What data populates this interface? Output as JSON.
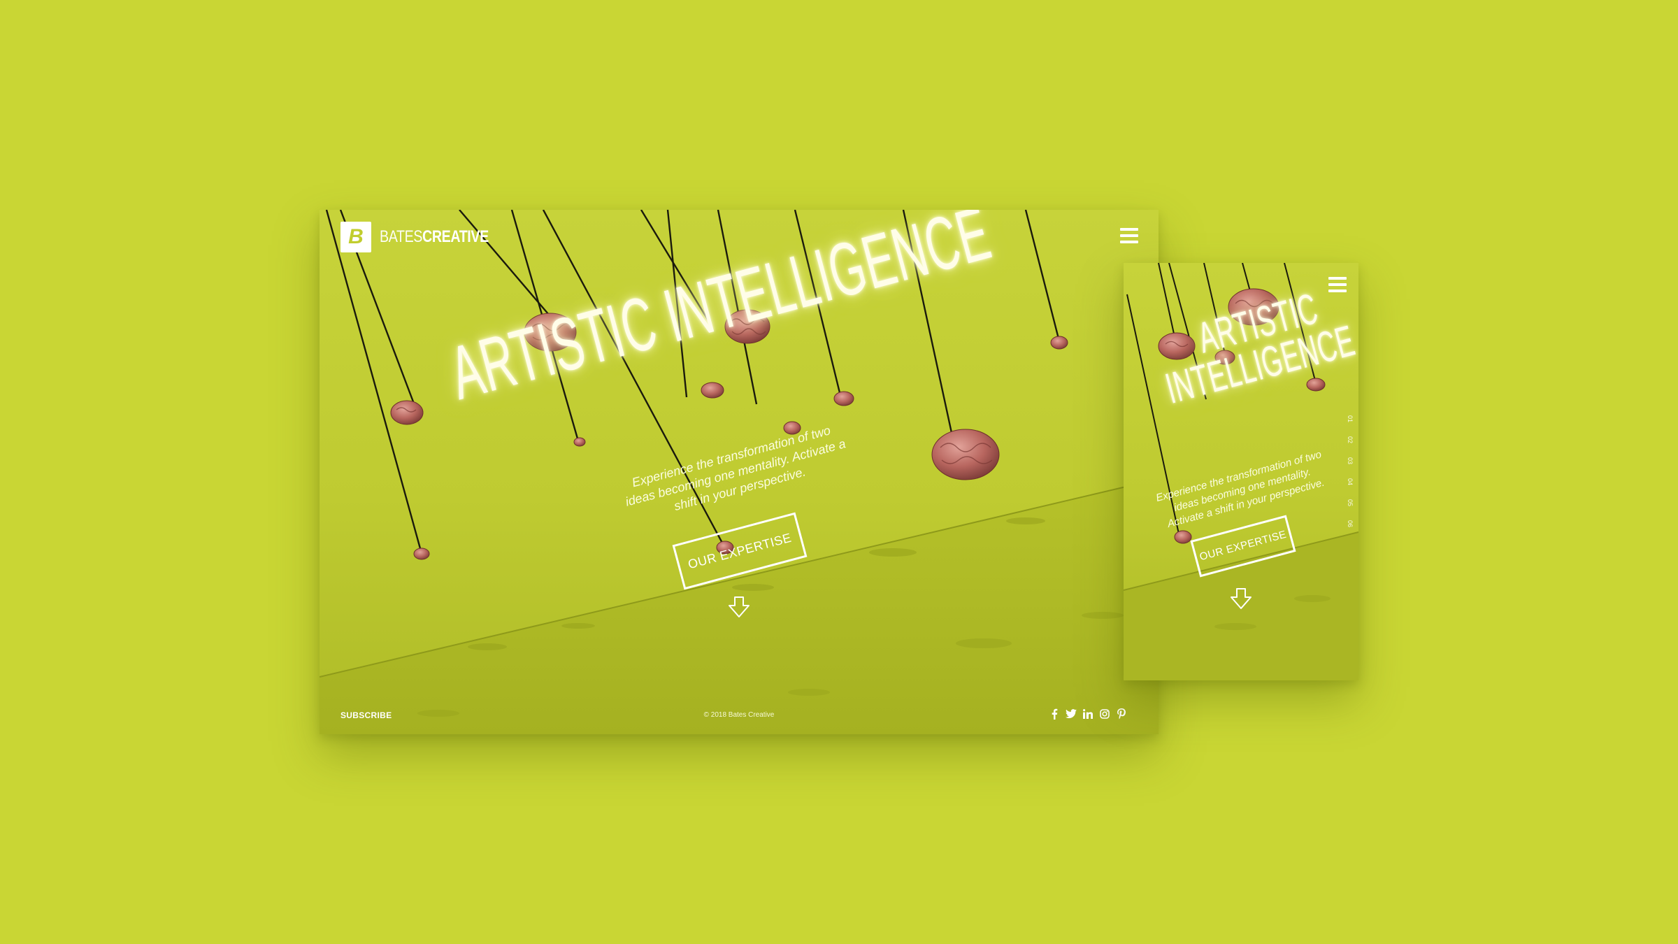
{
  "colors": {
    "background": "#c9d634",
    "accent": "#c1cd2e",
    "text": "#ffffff"
  },
  "brand": {
    "logo_letter": "B",
    "name_part1": "BATES",
    "name_part2": "CREATIVE"
  },
  "hero": {
    "headline": "ARTISTIC INTELLIGENCE",
    "headline_mobile_line1": "ARTISTIC",
    "headline_mobile_line2": "INTELLIGENCE",
    "tagline": "Experience the transformation of two ideas becoming one mentality. Activate a shift in your perspective.",
    "cta_label": "OUR EXPERTISE"
  },
  "footer": {
    "subscribe_label": "SUBSCRIBE",
    "copyright": "© 2018 Bates Creative",
    "social_icons": [
      "facebook-icon",
      "twitter-icon",
      "linkedin-icon",
      "instagram-icon",
      "pinterest-icon"
    ]
  },
  "mobile": {
    "pager": [
      "01",
      "02",
      "03",
      "04",
      "05",
      "06"
    ]
  }
}
